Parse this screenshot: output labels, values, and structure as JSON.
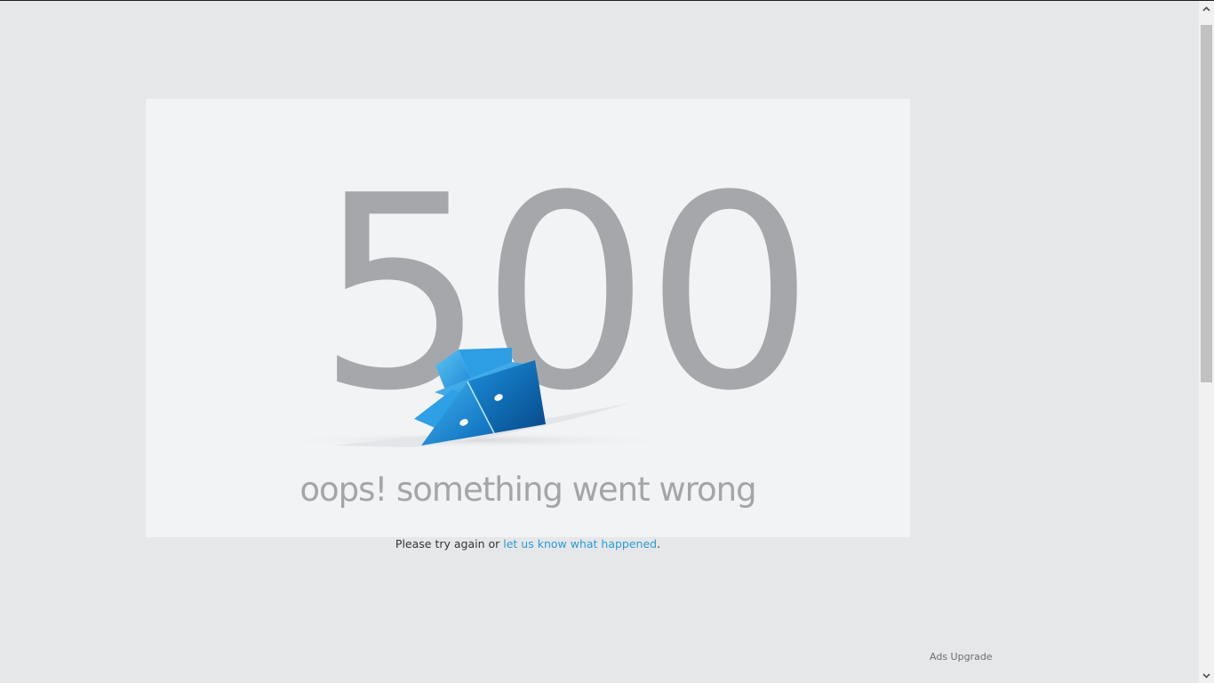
{
  "error": {
    "code": "500",
    "message": "oops! something went wrong"
  },
  "help": {
    "prefix": "Please try again or ",
    "link_text": "let us know what happened",
    "suffix": "."
  },
  "footer": {
    "ads_upgrade": "Ads Upgrade"
  },
  "colors": {
    "page_background": "#e6e7e9",
    "card_background": "#f2f3f5",
    "code_gray": "#a6a7ab",
    "link_blue": "#2a9bd6",
    "ship_blue": "#1e8fd8"
  },
  "icons": {
    "mascot": "sinking-blue-ship-icon",
    "scroll_up": "chevron-up-icon",
    "scroll_down": "chevron-down-icon"
  }
}
